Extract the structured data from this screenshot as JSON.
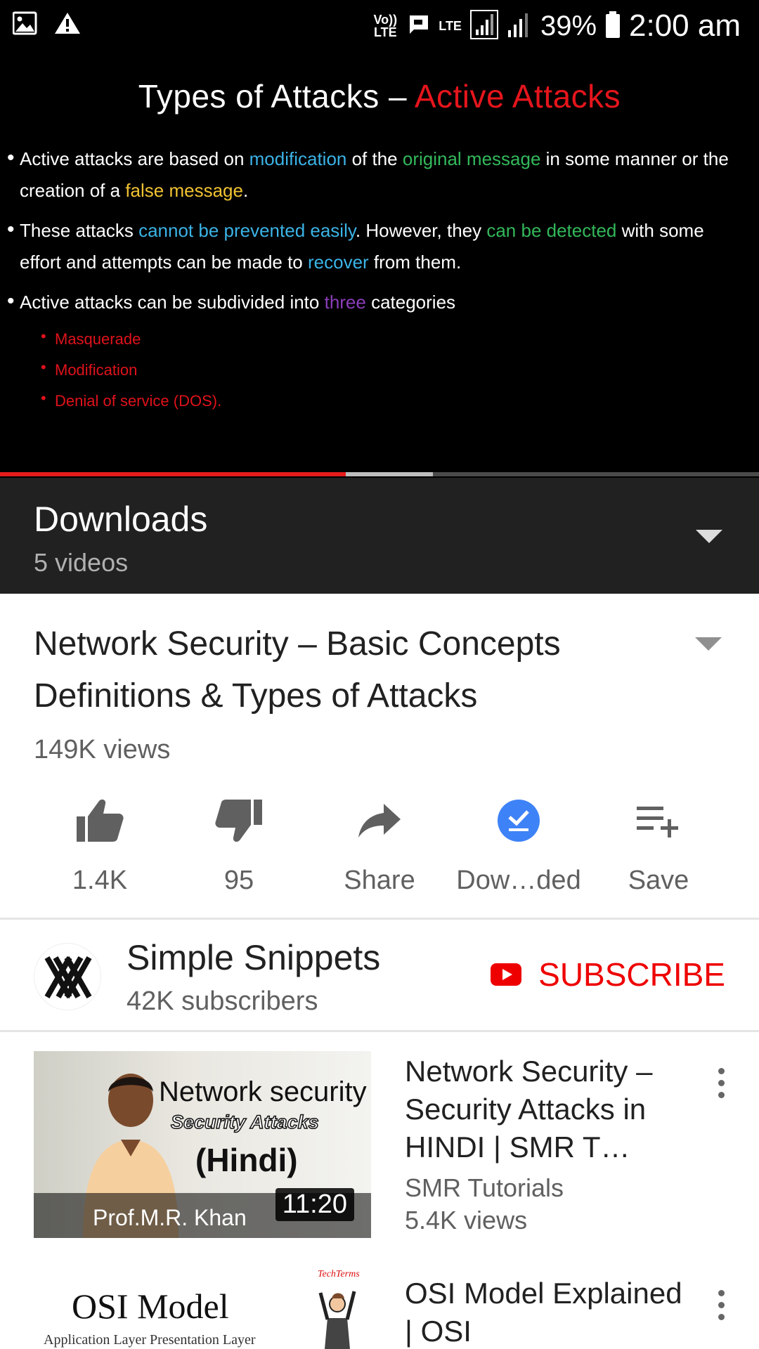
{
  "status_bar": {
    "volte": "Vo)) LTE",
    "lte": "LTE",
    "battery": "39%",
    "time": "2:00 am"
  },
  "slide": {
    "title_prefix": "Types of Attacks – ",
    "title_highlight": "Active Attacks",
    "bullet1": {
      "t1": "Active attacks are based on ",
      "h1": "modification",
      "t2": " of the ",
      "h2": "original message",
      "t3": " in some manner or the creation of a ",
      "h3": "false message",
      "t4": "."
    },
    "bullet2": {
      "t1": "These attacks ",
      "h1": "cannot be prevented easily",
      "t2": ". However, they ",
      "h2": "can be detected",
      "t3": " with some effort and attempts can be made to ",
      "h3": "recover",
      "t4": " from them."
    },
    "bullet3": {
      "t1": "Active attacks can be subdivided into ",
      "h1": "three",
      "t2": " categories"
    },
    "categories": [
      "Masquerade",
      "Modification",
      "Denial of service (DOS)."
    ]
  },
  "progress": {
    "played_fraction": 0.456,
    "buffered_fraction": 0.57
  },
  "downloads": {
    "title": "Downloads",
    "count": "5 videos"
  },
  "video": {
    "title": "Network Security – Basic Concepts Definitions & Types of Attacks",
    "views": "149K views"
  },
  "actions": {
    "likes": "1.4K",
    "dislikes": "95",
    "share": "Share",
    "downloaded": "Dow…ded",
    "save": "Save"
  },
  "channel": {
    "name": "Simple Snippets",
    "subscribers": "42K subscribers",
    "subscribe": "SUBSCRIBE"
  },
  "related": [
    {
      "thumb_line1": "Network security",
      "thumb_line2": "Security Attacks",
      "thumb_line3": "(Hindi)",
      "thumb_author": "Prof.M.R. Khan",
      "duration": "11:20",
      "title": "Network Security – Security Attacks in HINDI | SMR T…",
      "channel": "SMR Tutorials",
      "views": "5.4K views"
    },
    {
      "thumb_title": "OSI Model",
      "thumb_subtitle": "Application Layer  Presentation Layer",
      "thumb_brand": "TechTerms",
      "title": "OSI Model Explained | OSI"
    }
  ],
  "colors": {
    "accent_red": "#e61c1c",
    "subscribe_red": "#ee0000",
    "download_blue": "#3e82f7"
  }
}
